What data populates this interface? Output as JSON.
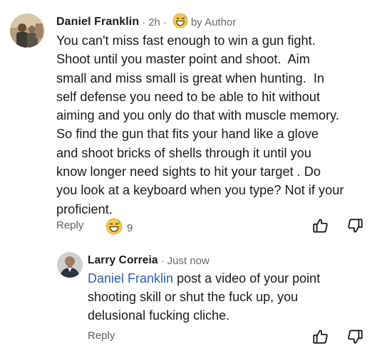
{
  "comments": [
    {
      "author": "Daniel Franklin",
      "separator": "·",
      "time": "2h",
      "separator2": "·",
      "badge_icon": "grinning-sweat-emoji",
      "tag": "by Author",
      "body_lines": [
        "You can't miss fast enough to win a gun fight.",
        "Shoot until you master point and shoot.  Aim",
        "small and miss small is great when hunting.  In",
        "self defense you need to be able to hit without",
        "aiming and you only do that with muscle memory.",
        "So find the gun that fits your hand like a glove",
        "and shoot bricks of shells through it until you",
        "know longer need sights to hit your target . Do",
        "you look at a keyboard when you type? Not if your",
        "proficient."
      ],
      "reply_label": "Reply",
      "reaction_icon": "grinning-sweat-emoji",
      "reaction_count": "9",
      "like_icon": "thumbs-up-icon",
      "dislike_icon": "thumbs-down-icon"
    },
    {
      "author": "Larry Correia",
      "separator": "·",
      "time": "Just now",
      "mention": "Daniel Franklin",
      "body_line1_rest": " post a video of your point",
      "body_lines": [
        "shooting skill or shut the fuck up, you",
        "delusional fucking cliche."
      ],
      "reply_label": "Reply",
      "like_icon": "thumbs-up-icon",
      "dislike_icon": "thumbs-down-icon"
    }
  ],
  "colors": {
    "text": "#1a1a1a",
    "meta": "#6b6b6b",
    "mention": "#2c5faa",
    "action": "#5e5e5e"
  }
}
